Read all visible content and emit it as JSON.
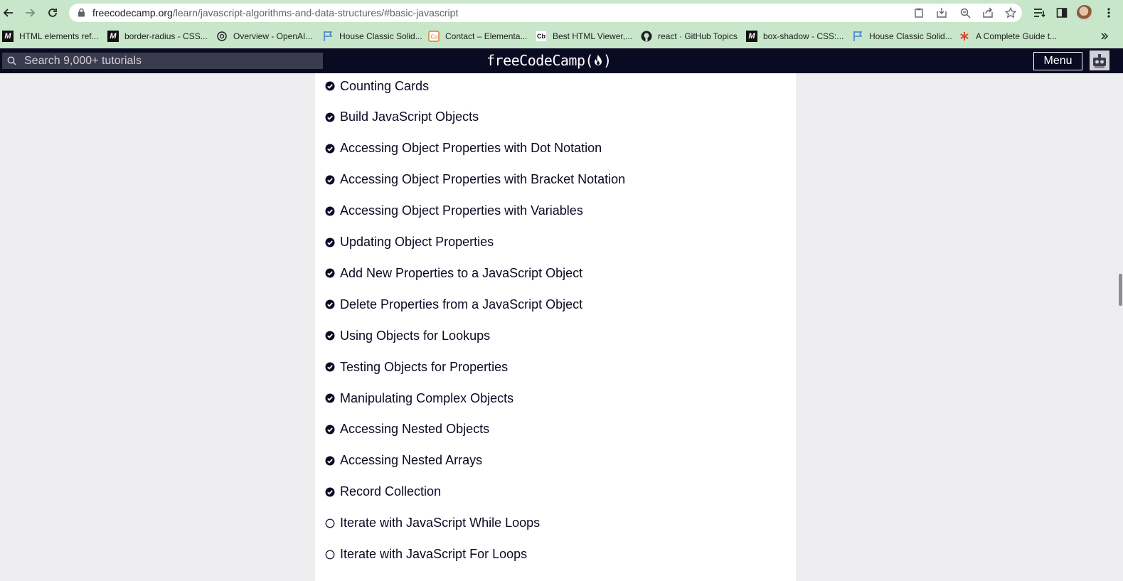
{
  "browser": {
    "url_host": "freecodecamp.org",
    "url_path": "/learn/javascript-algorithms-and-data-structures/#basic-javascript",
    "icons": [
      "back-arrow-icon",
      "forward-arrow-icon",
      "reload-icon",
      "lock-icon",
      "clipboard-icon",
      "install-icon",
      "zoom-icon",
      "share-icon",
      "star-icon",
      "reading-list-icon",
      "side-panel-icon",
      "more-icon"
    ]
  },
  "bookmarks": [
    {
      "label": "HTML elements ref...",
      "icon": "mdn-icon"
    },
    {
      "label": "border-radius - CSS...",
      "icon": "mdn-icon"
    },
    {
      "label": "Overview - OpenAI...",
      "icon": "openai-icon"
    },
    {
      "label": "House Classic Solid...",
      "icon": "flag-icon"
    },
    {
      "label": "Contact – Elementa...",
      "icon": "elementa-icon"
    },
    {
      "label": "Best HTML Viewer,...",
      "icon": "cb-icon"
    },
    {
      "label": "react · GitHub Topics",
      "icon": "github-icon"
    },
    {
      "label": "box-shadow - CSS:...",
      "icon": "mdn-icon"
    },
    {
      "label": "House Classic Solid...",
      "icon": "flag-icon"
    },
    {
      "label": "A Complete Guide t...",
      "icon": "asterisk-icon"
    }
  ],
  "fcc": {
    "search_placeholder": "Search 9,000+ tutorials",
    "logo_text": "freeCodeCamp(",
    "logo_close": ")",
    "menu_label": "Menu"
  },
  "challenges": [
    {
      "title": "Counting Cards",
      "completed": true
    },
    {
      "title": "Build JavaScript Objects",
      "completed": true
    },
    {
      "title": "Accessing Object Properties with Dot Notation",
      "completed": true
    },
    {
      "title": "Accessing Object Properties with Bracket Notation",
      "completed": true
    },
    {
      "title": "Accessing Object Properties with Variables",
      "completed": true
    },
    {
      "title": "Updating Object Properties",
      "completed": true
    },
    {
      "title": "Add New Properties to a JavaScript Object",
      "completed": true
    },
    {
      "title": "Delete Properties from a JavaScript Object",
      "completed": true
    },
    {
      "title": "Using Objects for Lookups",
      "completed": true
    },
    {
      "title": "Testing Objects for Properties",
      "completed": true
    },
    {
      "title": "Manipulating Complex Objects",
      "completed": true
    },
    {
      "title": "Accessing Nested Objects",
      "completed": true
    },
    {
      "title": "Accessing Nested Arrays",
      "completed": true
    },
    {
      "title": "Record Collection",
      "completed": true
    },
    {
      "title": "Iterate with JavaScript While Loops",
      "completed": false
    },
    {
      "title": "Iterate with JavaScript For Loops",
      "completed": false
    }
  ],
  "colors": {
    "browser_chrome": "#c8e6c9",
    "fcc_nav": "#0a0a23",
    "search_bg": "#3b3b4f",
    "page_bg": "#eeeef0",
    "text": "#0a0a23"
  }
}
